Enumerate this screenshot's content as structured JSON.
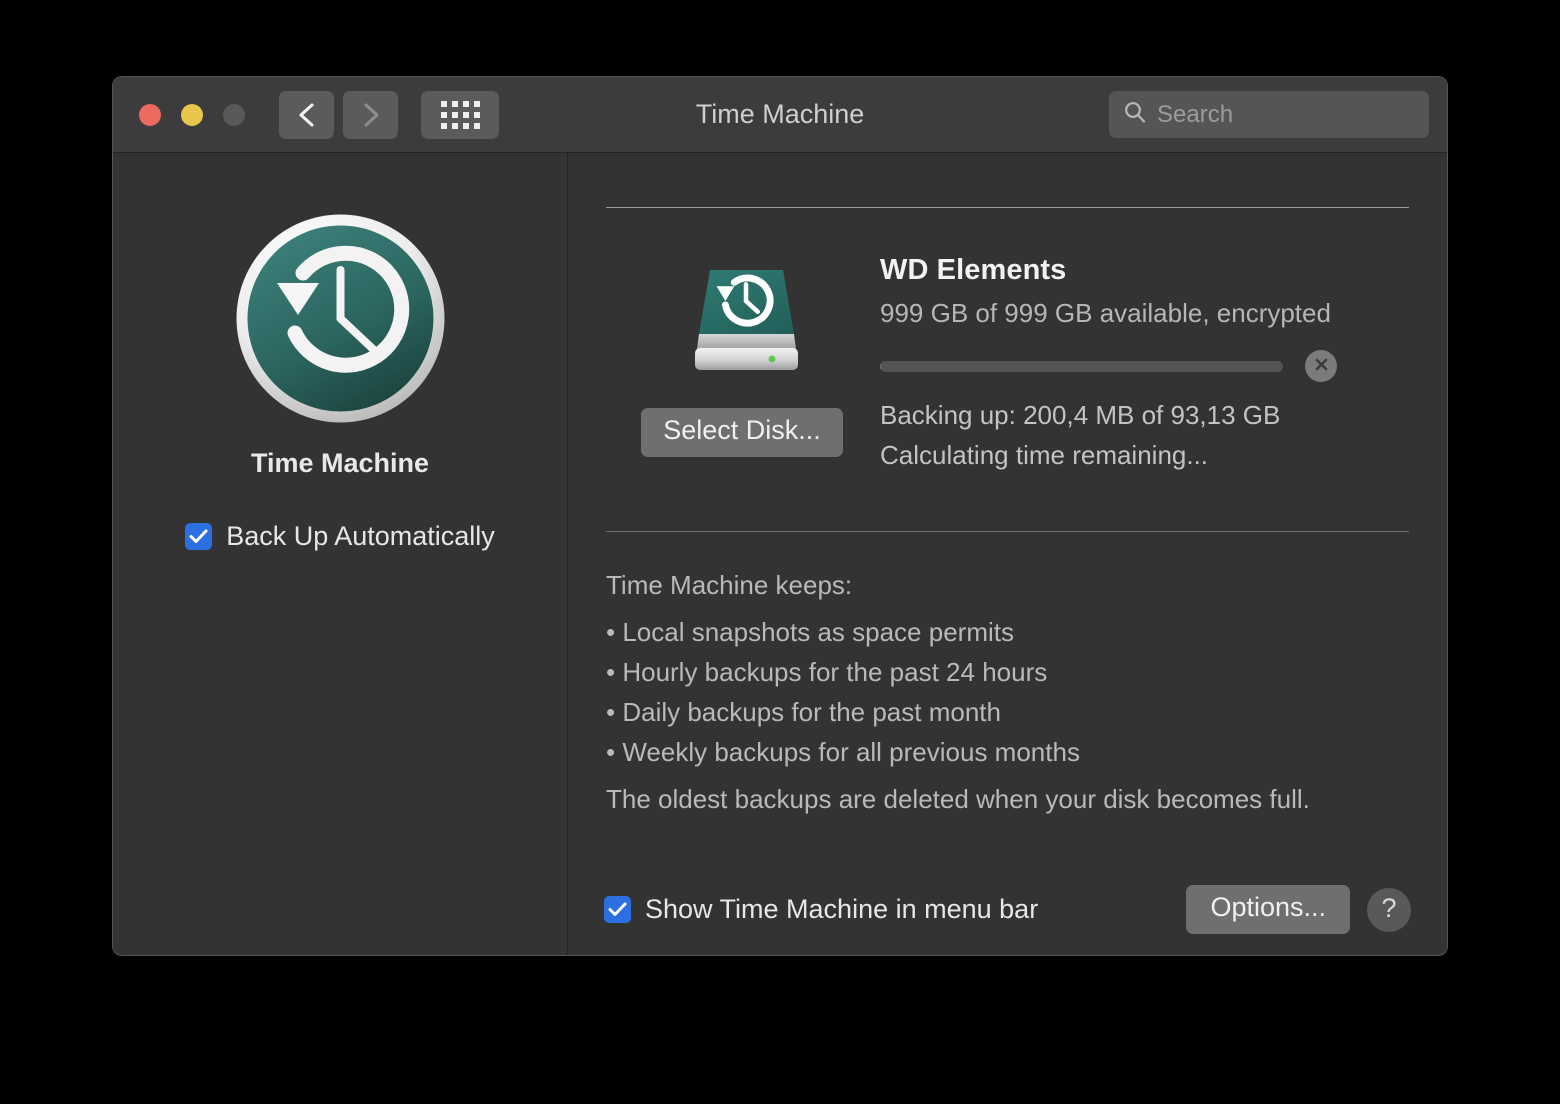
{
  "window": {
    "title": "Time Machine",
    "traffic_lights": [
      {
        "name": "close",
        "color": "#ec6a5f"
      },
      {
        "name": "minimize",
        "color": "#e6c74c"
      },
      {
        "name": "zoom",
        "color": "#595959"
      }
    ],
    "nav": {
      "back": "back-chevron",
      "forward": "forward-chevron"
    },
    "grid_button": "show-all-preferences"
  },
  "search": {
    "placeholder": "Search",
    "value": ""
  },
  "sidebar": {
    "app_icon": "time-machine-icon",
    "app_label": "Time Machine",
    "backup_auto": {
      "label": "Back Up Automatically",
      "checked": true
    }
  },
  "disk": {
    "icon": "external-backup-disk-icon",
    "select_disk_label": "Select Disk...",
    "name": "WD Elements",
    "available": "999 GB of 999 GB available, encrypted",
    "progress_percent": 0.2,
    "stop_button": "stop-backup-icon",
    "backing_up": "Backing up: 200,4 MB of 93,13 GB",
    "time_remaining": "Calculating time remaining..."
  },
  "keeps": {
    "title": "Time Machine keeps:",
    "items": [
      "• Local snapshots as space permits",
      "• Hourly backups for the past 24 hours",
      "• Daily backups for the past month",
      "• Weekly backups for all previous months"
    ],
    "note": "The oldest backups are deleted when your disk becomes full."
  },
  "footer": {
    "menu_bar": {
      "label": "Show Time Machine in menu bar",
      "checked": true
    },
    "options_label": "Options...",
    "help_label": "?"
  },
  "colors": {
    "accent_checkbox": "#2b6fe0",
    "window_bg": "#333333",
    "titlebar_bg": "#3c3c3e",
    "teal_icon": "#2d6a66",
    "button_gray": "#6f6f71"
  }
}
